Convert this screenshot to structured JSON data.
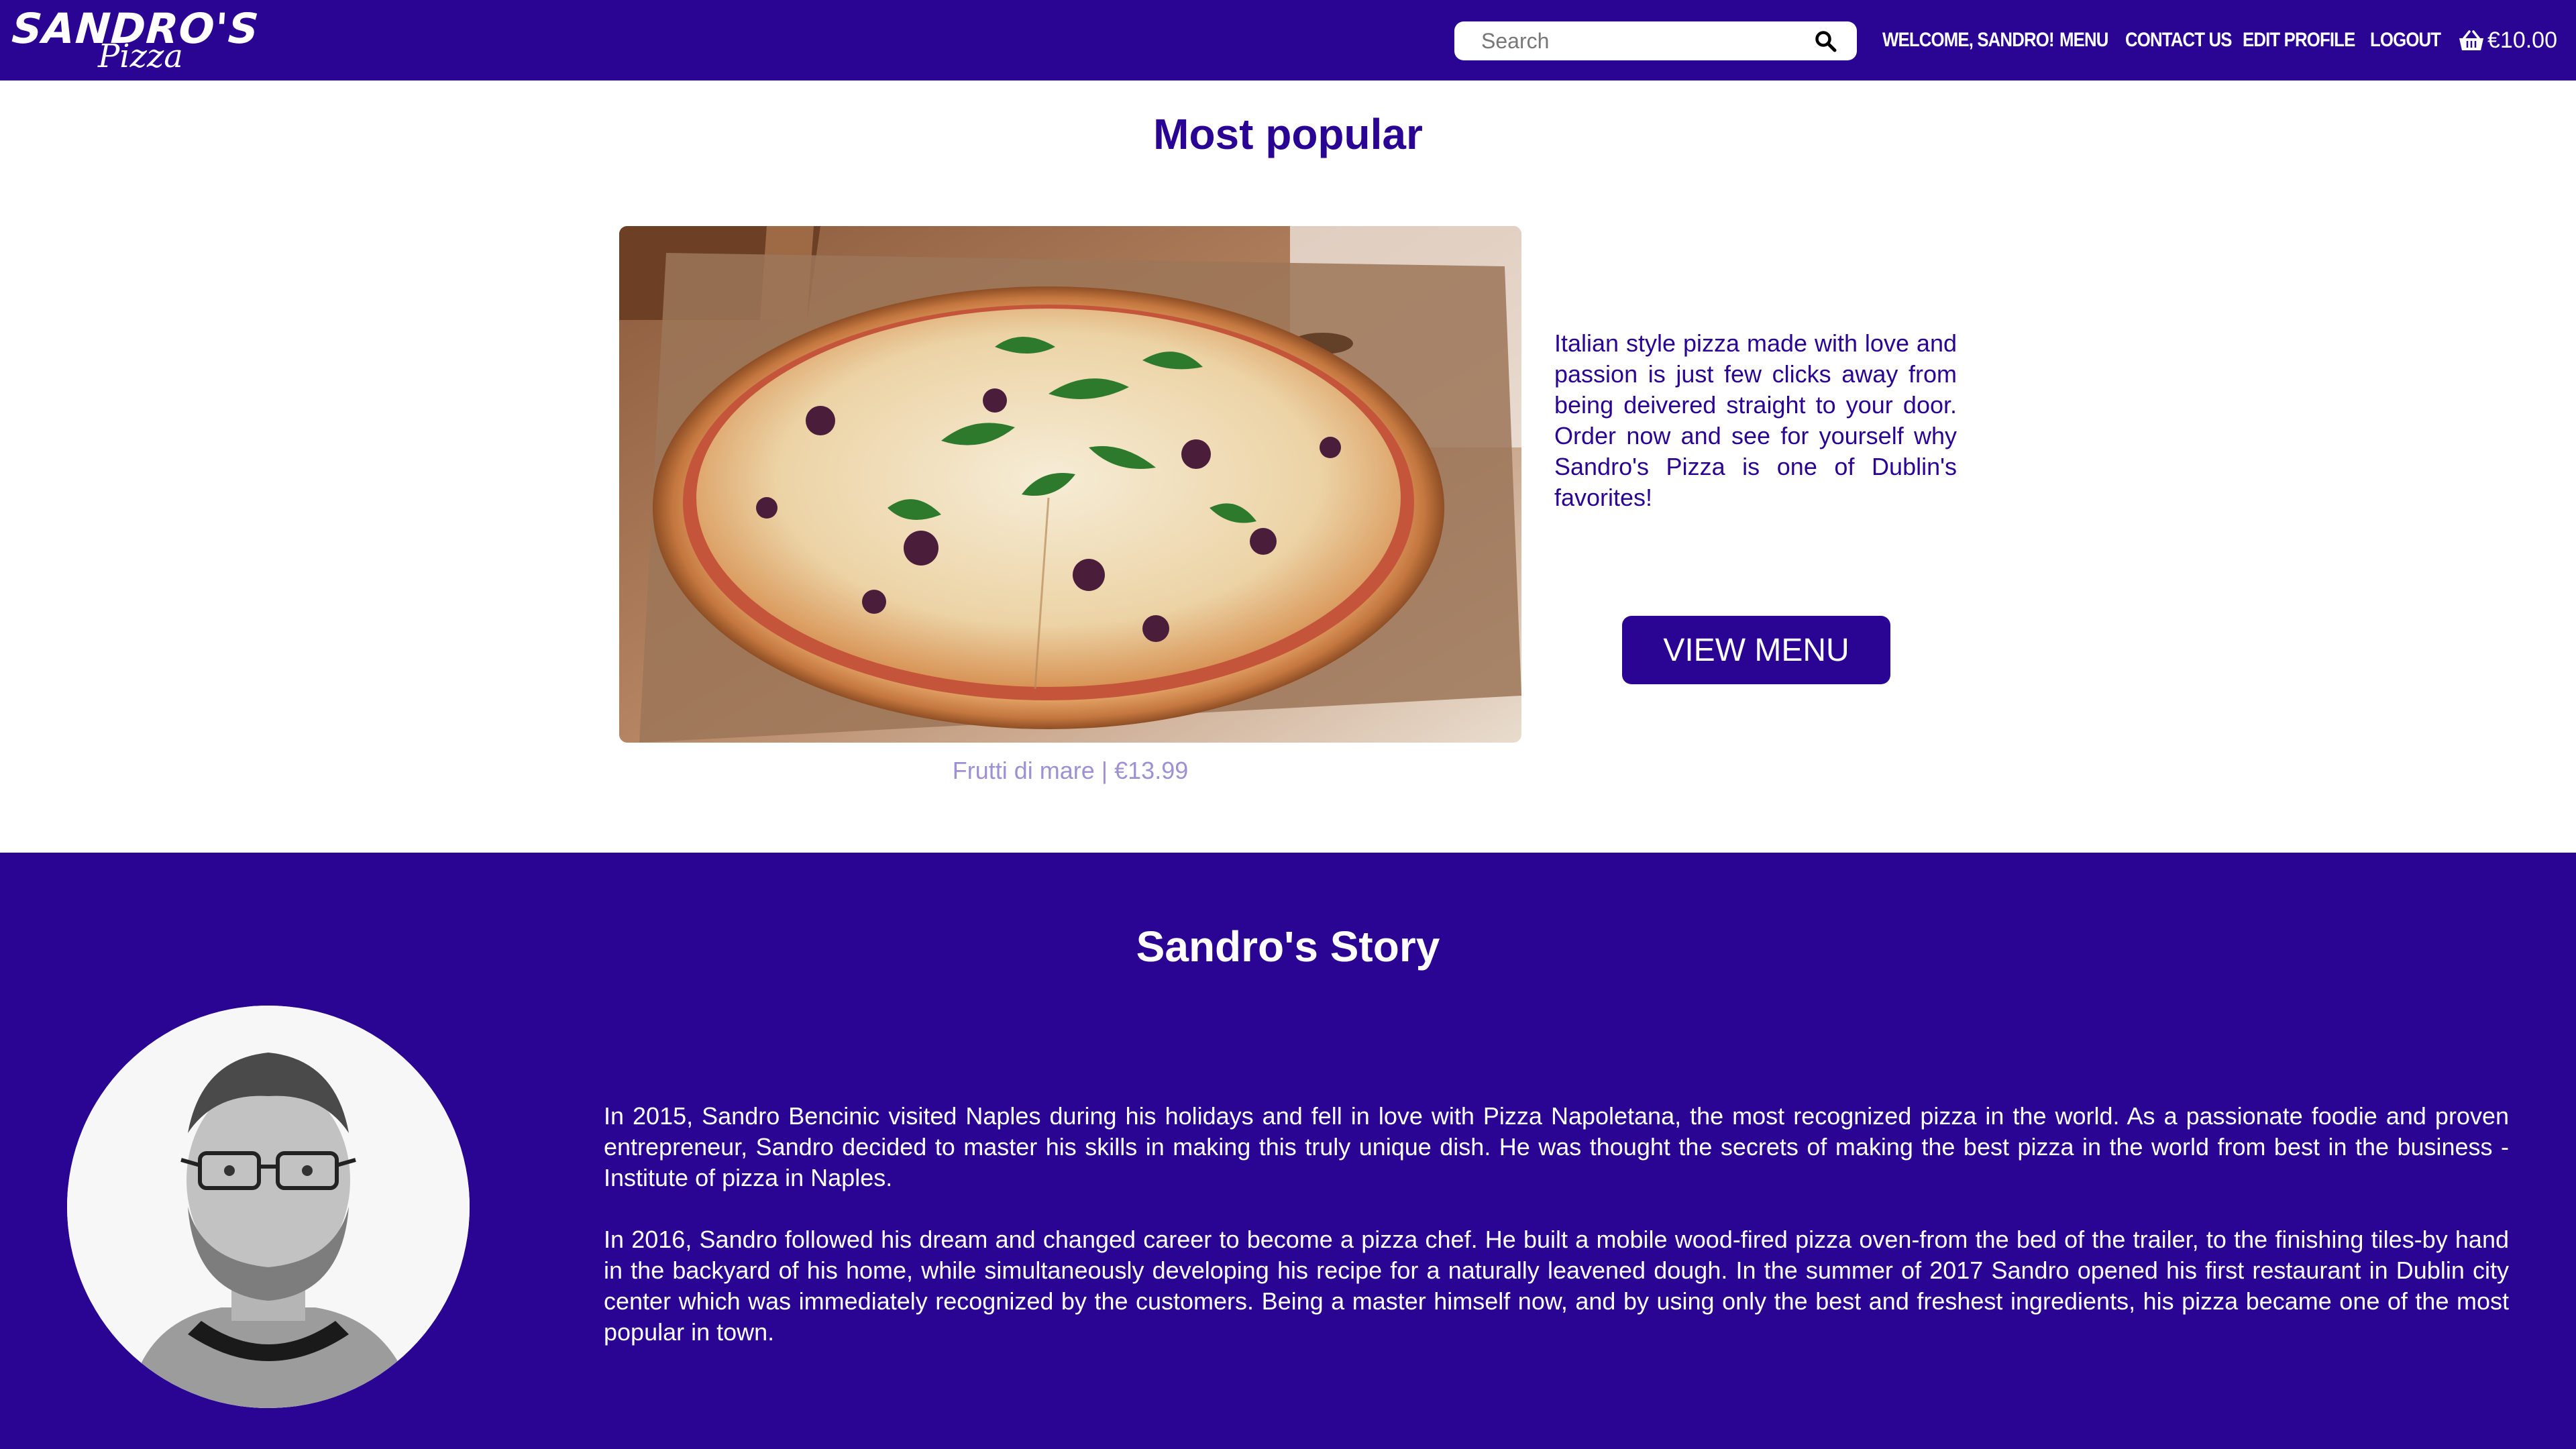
{
  "navbar": {
    "logo_main": "SANDRO'S",
    "logo_sub": "Pizza",
    "search_placeholder": "Search",
    "links": [
      {
        "label": "Welcome, Sandro!"
      },
      {
        "label": "Menu"
      },
      {
        "label": "Contact Us"
      },
      {
        "label": "Edit Profile"
      },
      {
        "label": "Logout"
      }
    ],
    "cart_total": "€10.00"
  },
  "popular": {
    "title": "Most popular",
    "featured_caption": "Frutti di mare | €13.99",
    "intro": "Italian style pizza made with love and passion is just few clicks away from being deivered straight to your door. Order now and see for yourself why Sandro's Pizza is one of Dublin's favorites!",
    "button_label": "VIEW MENU"
  },
  "story": {
    "title": "Sandro's Story",
    "paragraphs": [
      "In 2015, Sandro Bencinic visited Naples during his holidays and fell in love with Pizza Napoletana, the most recognized pizza in the world. As a passionate foodie and proven entrepreneur, Sandro decided to master his skills in making this truly unique dish. He was thought the secrets of making the best pizza in the world from best in the business - Institute of pizza in Naples.",
      "In 2016, Sandro followed his dream and changed career to become a pizza chef. He built a mobile wood-fired pizza oven-from the bed of the trailer, to the finishing tiles-by hand in the backyard of his home, while simultaneously developing his recipe for a naturally leavened dough. In the summer of 2017 Sandro opened his first restaurant in Dublin city center which was immediately recognized by the customers. Being a master himself now, and by using only the best and freshest ingredients, his pizza became one of the most popular in town."
    ]
  },
  "icons": {
    "search": "search-icon",
    "cart": "basket-icon"
  },
  "colors": {
    "brand": "#2a0594",
    "caption": "#9d91d4",
    "background": "#ffffff"
  }
}
